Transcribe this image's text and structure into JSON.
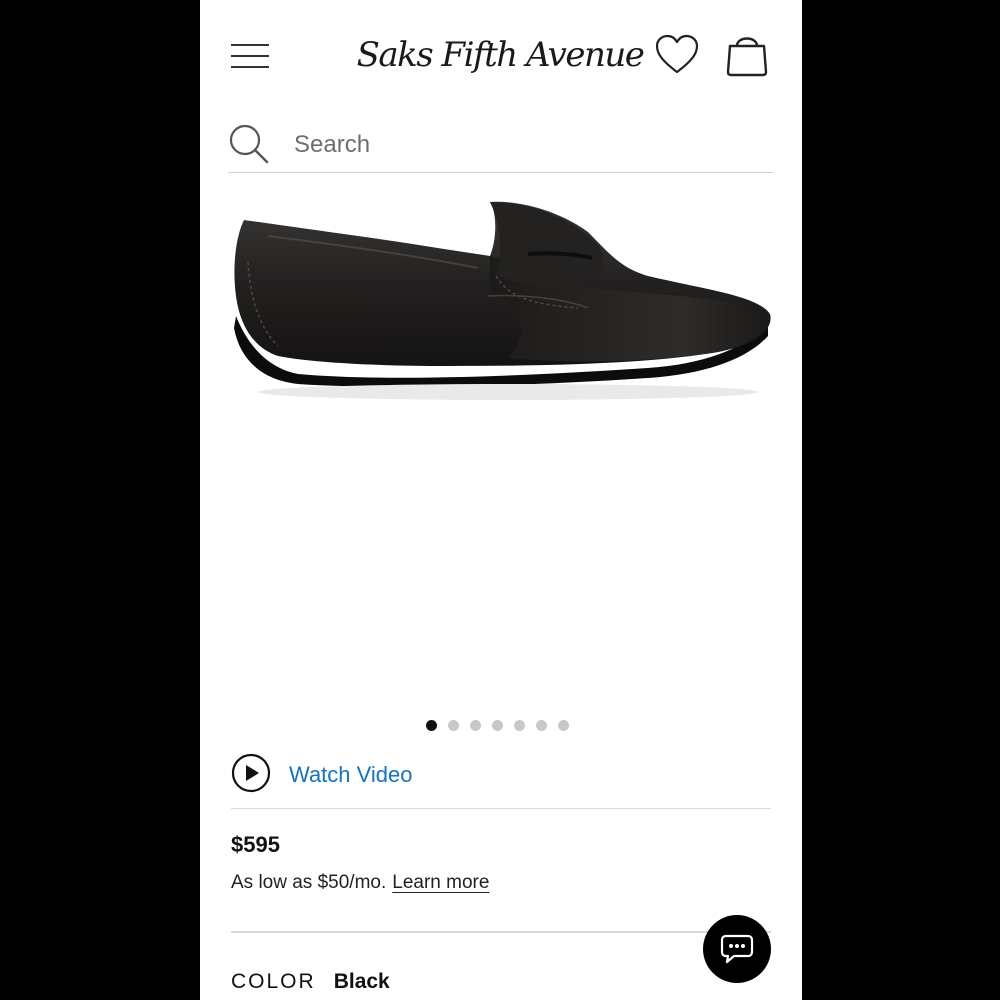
{
  "header": {
    "logo_text": "Saks Fifth Avenue",
    "menu_icon": "hamburger-menu-icon",
    "wishlist_icon": "heart-icon",
    "bag_icon": "shopping-bag-icon"
  },
  "search": {
    "placeholder": "Search",
    "value": "",
    "icon": "search-icon"
  },
  "product": {
    "image_icon": "loafer-shoe-image",
    "carousel": {
      "total": 7,
      "active": 1
    },
    "watch_video_label": "Watch Video",
    "price": "$595",
    "financing_text": "As low as $50/mo.",
    "learn_more_label": "Learn more",
    "color_label": "COLOR",
    "color_value": "Black"
  },
  "chat": {
    "icon": "chat-bubble-icon"
  },
  "colors": {
    "link": "#1273c8",
    "dot_active": "#111111",
    "dot_inactive": "#c8c8c8"
  }
}
